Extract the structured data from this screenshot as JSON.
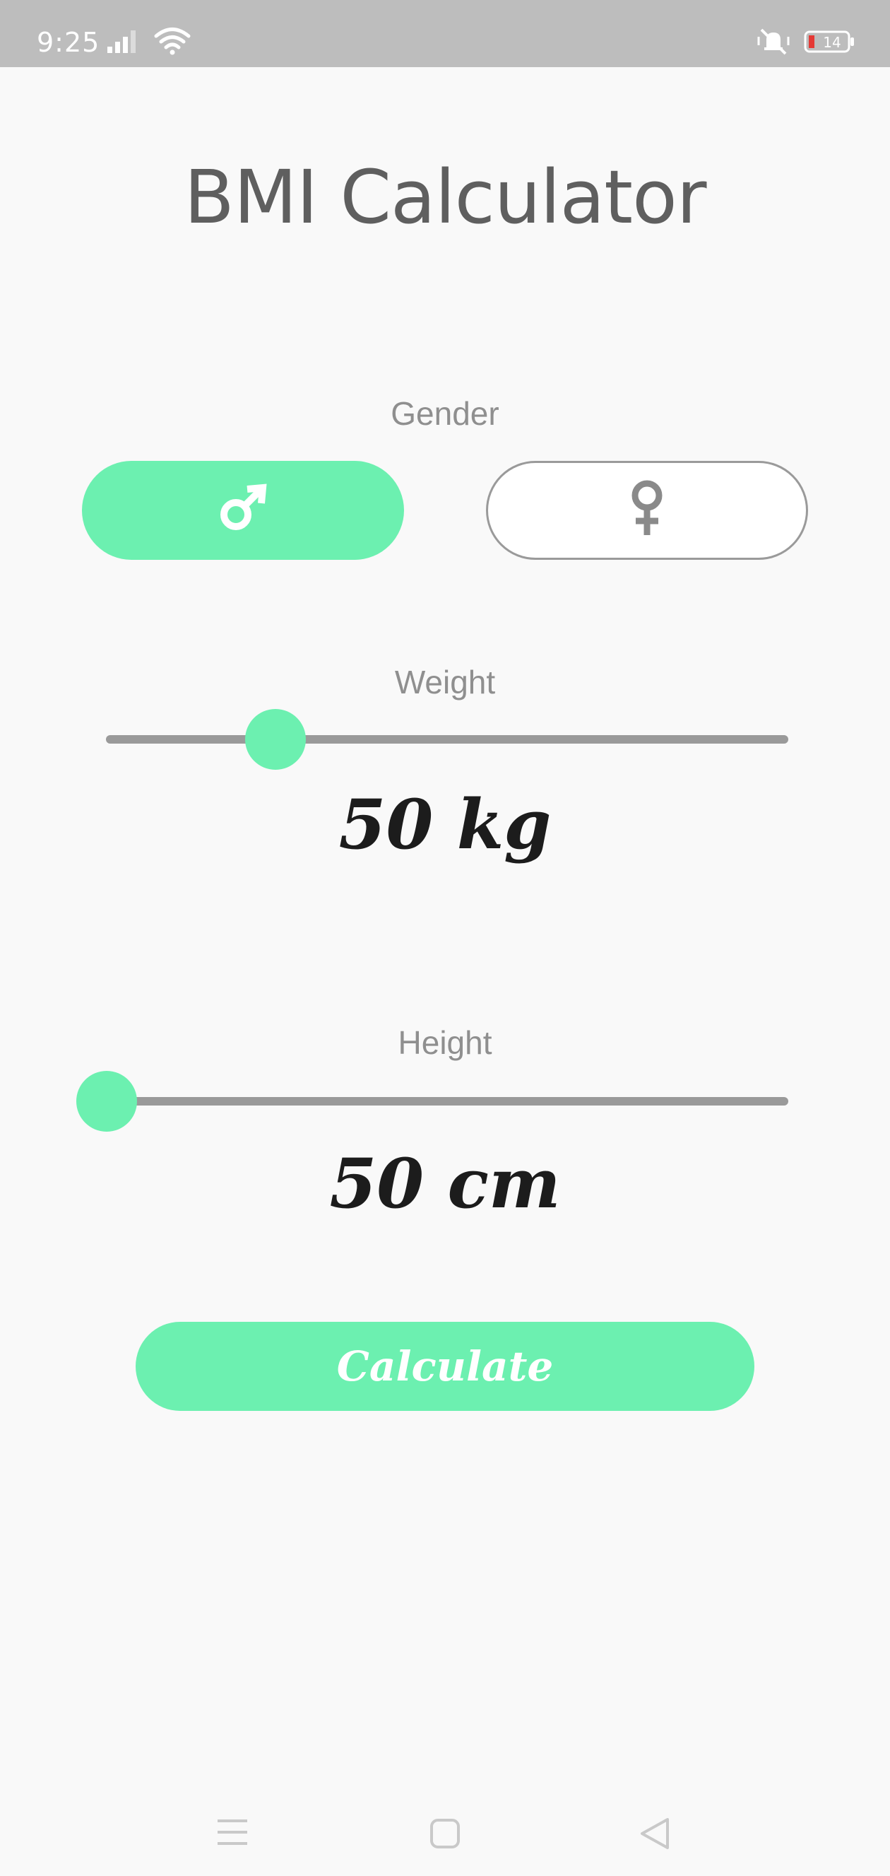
{
  "status_bar": {
    "time": "9:25",
    "battery_level": "14",
    "icons": [
      "signal-icon",
      "wifi-icon",
      "mute-icon",
      "battery-icon"
    ]
  },
  "app": {
    "title": "BMI Calculator",
    "accent_color": "#6cf0b0"
  },
  "gender": {
    "label": "Gender",
    "options": [
      {
        "icon": "male-icon",
        "selected": true
      },
      {
        "icon": "female-icon",
        "selected": false
      }
    ]
  },
  "weight": {
    "label": "Weight",
    "value_text": "50 kg",
    "slider_fraction": 0.25
  },
  "height": {
    "label": "Height",
    "value_text": "50 cm",
    "slider_fraction": 0.0
  },
  "calculate": {
    "label": "Calculate"
  },
  "nav_bar": {
    "icons": [
      "menu-icon",
      "home-icon",
      "back-icon"
    ]
  }
}
